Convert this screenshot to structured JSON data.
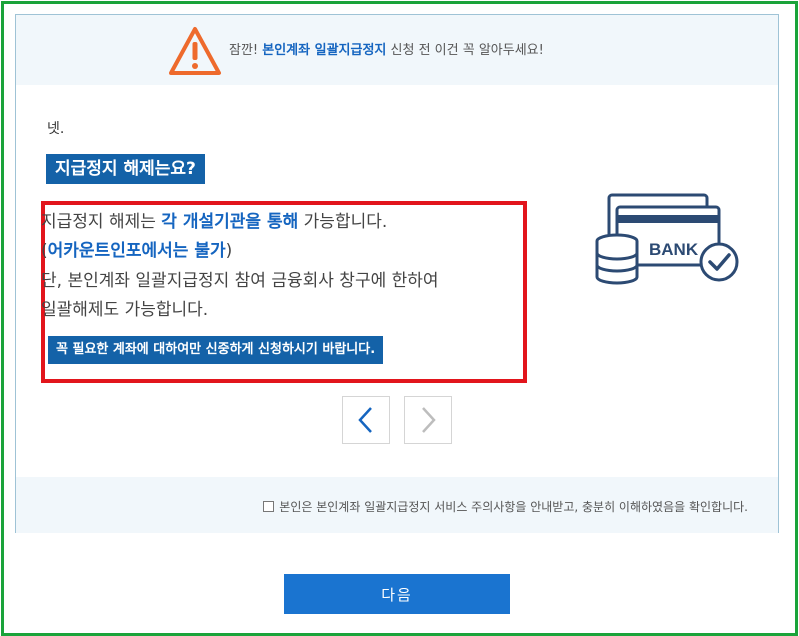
{
  "banner": {
    "prefix": "잠깐! ",
    "highlight": "본인계좌 일괄지급정지",
    "suffix": " 신청 전 이건 꼭 알아두세요!",
    "icon": "warning-triangle-icon"
  },
  "step": {
    "label": "넷."
  },
  "section": {
    "title": "지급정지 해제는요?"
  },
  "description": {
    "line1_a": "지급정지 해제는 ",
    "line1_hl": "각 개설기관을 통해",
    "line1_b": " 가능합니다.",
    "line2_open": "(",
    "line2_hl": "어카운트인포에서는 불가",
    "line2_close": ")",
    "line3": "단, 본인계좌 일괄지급정지 참여 금융회사 창구에 한하여",
    "line4": "일괄해제도 가능합니다."
  },
  "notice": {
    "text": "꼭 필요한 계좌에 대하여만 신중하게 신청하시기 바랍니다."
  },
  "illustration": {
    "bank_label": "BANK",
    "icon": "bank-cards-check-icon"
  },
  "pager": {
    "prev_icon": "chevron-left-icon",
    "next_icon": "chevron-right-icon"
  },
  "agreement": {
    "label": "본인은 본인계좌 일괄지급정지 서비스 주의사항을 안내받고, 충분히 이해하였음을 확인합니다.",
    "checked": false
  },
  "actions": {
    "next_label": "다음"
  },
  "colors": {
    "frame_green": "#1aa33a",
    "accent_blue": "#1462a8",
    "button_blue": "#1a74d0",
    "highlight_red": "#e2151c",
    "warning_orange": "#ee6a2c"
  }
}
